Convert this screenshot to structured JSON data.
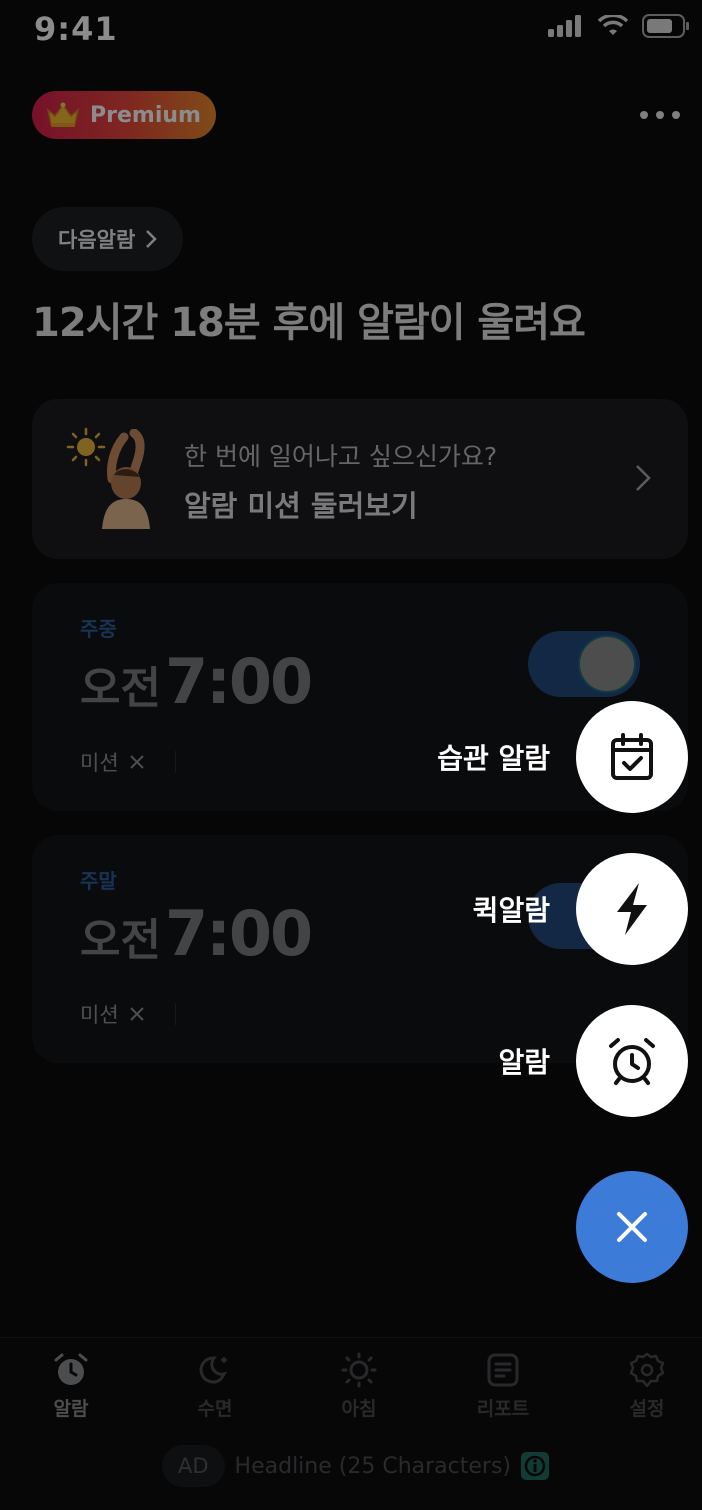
{
  "status_bar": {
    "time": "9:41"
  },
  "header": {
    "premium_label": "Premium",
    "next_alarm_label": "다음알람",
    "headline": "12시간 18분 후에 알람이 울려요"
  },
  "mission_card": {
    "subtitle": "한 번에 일어나고 싶으신가요?",
    "title": "알람 미션 둘러보기"
  },
  "alarms": [
    {
      "day": "주중",
      "ampm": "오전",
      "time": "7:00",
      "mission": "미션",
      "enabled": true
    },
    {
      "day": "주말",
      "ampm": "오전",
      "time": "7:00",
      "mission": "미션",
      "enabled": true
    }
  ],
  "fab_menu": {
    "items": [
      {
        "label": "습관 알람",
        "icon": "calendar-check-icon"
      },
      {
        "label": "퀵알람",
        "icon": "lightning-icon"
      },
      {
        "label": "알람",
        "icon": "alarm-clock-icon"
      }
    ]
  },
  "tabs": [
    {
      "label": "알람",
      "icon": "alarm-clock-icon",
      "active": true
    },
    {
      "label": "수면",
      "icon": "moon-icon",
      "active": false
    },
    {
      "label": "아침",
      "icon": "sun-icon",
      "active": false
    },
    {
      "label": "리포트",
      "icon": "report-icon",
      "active": false
    },
    {
      "label": "설정",
      "icon": "gear-icon",
      "active": false
    }
  ],
  "ad": {
    "badge": "AD",
    "text": "Headline (25 Characters)"
  },
  "colors": {
    "accent": "#3d7bd9",
    "premium_start": "#d81e4f",
    "premium_end": "#e8892c"
  }
}
